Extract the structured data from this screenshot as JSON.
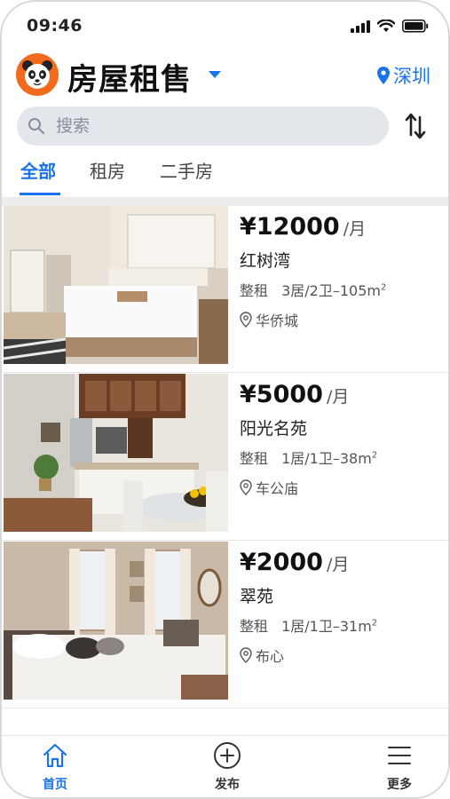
{
  "status_bar": {
    "time": "09:46"
  },
  "header": {
    "title": "房屋租售",
    "city": "深圳"
  },
  "search": {
    "placeholder": "搜索",
    "value": ""
  },
  "tabs": [
    {
      "label": "全部",
      "active": true
    },
    {
      "label": "租房",
      "active": false
    },
    {
      "label": "二手房",
      "active": false
    }
  ],
  "listings": [
    {
      "price": "¥12000",
      "unit": "/月",
      "name": "红树湾",
      "type": "整租",
      "rooms": "3居/2卫–105m",
      "sup": "2",
      "location": "华侨城"
    },
    {
      "price": "¥5000",
      "unit": "/月",
      "name": "阳光名苑",
      "type": "整租",
      "rooms": "1居/1卫–38m",
      "sup": "2",
      "location": "车公庙"
    },
    {
      "price": "¥2000",
      "unit": "/月",
      "name": "翠苑",
      "type": "整租",
      "rooms": "1居/1卫–31m",
      "sup": "2",
      "location": "布心"
    }
  ],
  "bottom_nav": [
    {
      "label": "首页",
      "icon": "home-icon",
      "active": true
    },
    {
      "label": "发布",
      "icon": "plus-circle-icon",
      "active": false
    },
    {
      "label": "更多",
      "icon": "menu-icon",
      "active": false
    }
  ],
  "colors": {
    "accent": "#1a73e8",
    "logo": "#f26a1b",
    "search_bg": "#e3e6ea"
  }
}
